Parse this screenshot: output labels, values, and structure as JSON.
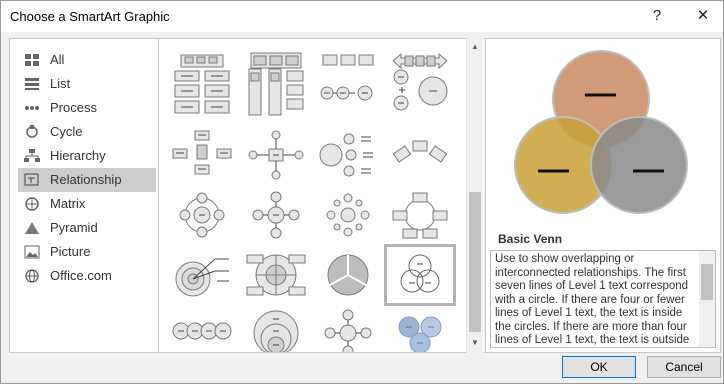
{
  "dialog": {
    "title": "Choose a SmartArt Graphic",
    "help_glyph": "?",
    "close_glyph": "✕"
  },
  "categories": [
    {
      "label": "All",
      "icon": "all-icon",
      "selected": false
    },
    {
      "label": "List",
      "icon": "list-icon",
      "selected": false
    },
    {
      "label": "Process",
      "icon": "process-icon",
      "selected": false
    },
    {
      "label": "Cycle",
      "icon": "cycle-icon",
      "selected": false
    },
    {
      "label": "Hierarchy",
      "icon": "hierarchy-icon",
      "selected": false
    },
    {
      "label": "Relationship",
      "icon": "relationship-icon",
      "selected": true
    },
    {
      "label": "Matrix",
      "icon": "matrix-icon",
      "selected": false
    },
    {
      "label": "Pyramid",
      "icon": "pyramid-icon",
      "selected": false
    },
    {
      "label": "Picture",
      "icon": "picture-icon",
      "selected": false
    },
    {
      "label": "Office.com",
      "icon": "globe-icon",
      "selected": false
    }
  ],
  "gallery": {
    "selected_item": "Basic Venn"
  },
  "preview": {
    "title": "Basic Venn",
    "description": "Use to show overlapping or interconnected relationships. The first seven lines of Level 1 text correspond with a circle. If there are four or fewer lines of Level 1 text, the text is inside the circles. If there are more than four lines of Level 1 text, the text is outside",
    "venn_colors": [
      "#c98a63",
      "#c9a035",
      "#8a8a8a"
    ],
    "venn_placeholder": "—"
  },
  "buttons": {
    "ok": "OK",
    "cancel": "Cancel"
  },
  "colors": {
    "accent_blue": "#0078d7",
    "selection_gray": "#cdcdcd"
  }
}
